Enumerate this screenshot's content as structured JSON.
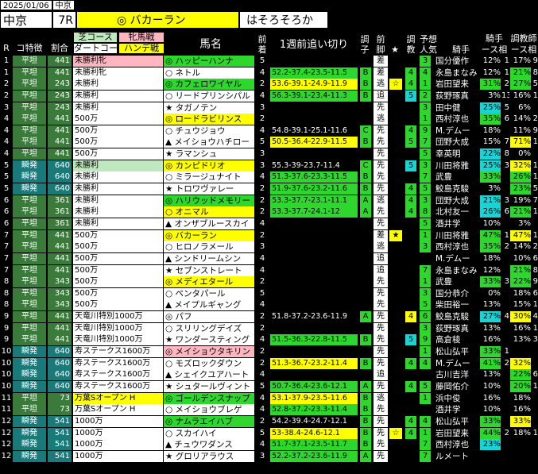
{
  "header": {
    "date": "2025/01/06",
    "place": "中京",
    "venue": "中京",
    "race": "7R",
    "favorite": "◎ バカーラン",
    "comment": "はそろそろか"
  },
  "columns": {
    "r": "R",
    "course_trait": "コ特徴",
    "ratio": "割合",
    "turf_course": "芝コース",
    "dirt_course": "ダートコー",
    "filly": "牝馬戦",
    "handicap": "ハンデ戦",
    "name": "馬名",
    "prev1": "前",
    "prev2": "着",
    "workout": "1週前追い切り",
    "cond1": "調",
    "cond2": "子",
    "pace1": "前",
    "pace2": "脚",
    "star": "★",
    "train1": "調",
    "train2": "教",
    "pop1": "予想",
    "pop2": "人気",
    "jockey": "騎手",
    "jstat1": "騎手",
    "jstat2": "ース相",
    "tstat1": "調教師",
    "tstat2": "ース相"
  },
  "rows": [
    {
      "r": "1",
      "trait": "平坦",
      "ratio": "441",
      "class": "未勝利牝",
      "cls": "pk",
      "name": "◎ ハッピーハンナ",
      "nc": "g",
      "prev": "5",
      "work": "",
      "wc": "",
      "cond": "",
      "pace": "差",
      "star": "",
      "tr": "",
      "tc": "",
      "pop": "3",
      "jockey": "国分優作",
      "js": "12%",
      "jn": "1",
      "ts": "17%",
      "tn": "9"
    },
    {
      "r": "1",
      "trait": "平坦",
      "ratio": "441",
      "class": "未勝利牝",
      "cls": "",
      "name": "○ ネトル",
      "nc": "",
      "prev": "4",
      "work": "52.2-37.4-23.5-11.5",
      "wc": "g",
      "cond": "B",
      "pace": "差",
      "star": "",
      "tr": "4",
      "tc": "gb",
      "pop": "4",
      "jockey": "永島まなみ",
      "js": "12%",
      "jn": "1",
      "ts": "21%",
      "tn": "8"
    },
    {
      "r": "2",
      "trait": "平坦",
      "ratio": "243",
      "class": "未勝利",
      "cls": "",
      "name": "◎ カフェロワイヤル",
      "nc": "g",
      "prev": "2",
      "work": "53.6-39.1-24.9-11.9",
      "wc": "y",
      "cond": "B",
      "pace": "逃",
      "star": "☆",
      "tr": "4",
      "tc": "gb",
      "pop": "1",
      "jockey": "岩田望来",
      "js": "31%",
      "jn": "2",
      "ts": "27%",
      "tn": "5"
    },
    {
      "r": "2",
      "trait": "平坦",
      "ratio": "243",
      "class": "未勝利",
      "cls": "",
      "name": "○ リードプリンシパル",
      "nc": "",
      "prev": "4",
      "work": "56.3-39.1-23.4-11.3",
      "wc": "g",
      "cond": "B",
      "pace": "追",
      "star": "",
      "tr": "5",
      "tc": "cy",
      "pop": "2",
      "jockey": "荻野琢真",
      "js": "3%",
      "jn": "13",
      "ts": "16%",
      "tn": "1"
    },
    {
      "r": "3",
      "trait": "平坦",
      "ratio": "243",
      "class": "未勝利",
      "cls": "",
      "name": "★ タガノテン",
      "nc": "",
      "prev": "3",
      "work": "",
      "wc": "",
      "cond": "",
      "pace": "先",
      "star": "",
      "tr": "",
      "tc": "",
      "pop": "3",
      "jockey": "田中健",
      "js": "25%",
      "jn": "5",
      "ts": "6%",
      "tn": ""
    },
    {
      "r": "4",
      "trait": "平坦",
      "ratio": "441",
      "class": "500万",
      "cls": "",
      "name": "◎ ロードラビリンス",
      "nc": "y",
      "prev": "2",
      "work": "",
      "wc": "",
      "cond": "",
      "pace": "逃",
      "star": "",
      "tr": "",
      "tc": "",
      "pop": "1",
      "jockey": "西村淳也",
      "js": "35%",
      "jn": "6",
      "ts": "14%",
      "tn": "2"
    },
    {
      "r": "4",
      "trait": "平坦",
      "ratio": "441",
      "class": "500万",
      "cls": "",
      "name": "○ チュウジョウ",
      "nc": "",
      "prev": "4",
      "work": "54.8-39.1-25.1-11.6",
      "wc": "",
      "cond": "C",
      "pace": "先",
      "star": "",
      "tr": "4",
      "tc": "gb",
      "pop": "9",
      "jockey": "M.デムー",
      "js": "18%",
      "jn": "",
      "ts": "11%",
      "tn": "9"
    },
    {
      "r": "4",
      "trait": "平坦",
      "ratio": "441",
      "class": "500万",
      "cls": "",
      "name": "▲ メイショウハチロー",
      "nc": "",
      "prev": "5",
      "work": "50.5-36.4-22.9-11.5",
      "wc": "y",
      "cond": "B",
      "pace": "先",
      "star": "",
      "tr": "5",
      "tc": "gb",
      "pop": "7",
      "jockey": "団野大成",
      "js": "15%",
      "jn": "7",
      "ts": "71%",
      "tn": "1"
    },
    {
      "r": "4",
      "trait": "平坦",
      "ratio": "441",
      "class": "500万",
      "cls": "",
      "name": "★ ラマンシュ",
      "nc": "",
      "prev": "3",
      "work": "",
      "wc": "",
      "cond": "",
      "pace": "先",
      "star": "",
      "tr": "",
      "tc": "",
      "pop": "5",
      "jockey": "幸英明",
      "js": "22%",
      "jn": "8",
      "ts": "0%",
      "tn": ""
    },
    {
      "r": "5",
      "trait": "瞬発",
      "ratio": "640",
      "class": "未勝利",
      "cls": "gr",
      "name": "◎ カンピドリオ",
      "nc": "y",
      "prev": "3",
      "work": "55.3-39-23.7-11.4",
      "wc": "",
      "cond": "C",
      "pace": "先",
      "star": "",
      "tr": "5",
      "tc": "cy",
      "pop": "3",
      "jockey": "川田将雅",
      "js": "25%",
      "jn": "3",
      "ts": "32%",
      "tn": "1"
    },
    {
      "r": "5",
      "trait": "瞬発",
      "ratio": "640",
      "class": "未勝利",
      "cls": "",
      "name": "○ ミラージュナイト",
      "nc": "",
      "prev": "4",
      "work": "51.3-37.6-23.3-11.5",
      "wc": "g",
      "cond": "B",
      "pace": "先",
      "star": "",
      "tr": "",
      "tc": "",
      "pop": "7",
      "jockey": "武豊",
      "js": "33%",
      "jn": "",
      "ts": "26%",
      "tn": "1"
    },
    {
      "r": "5",
      "trait": "瞬発",
      "ratio": "640",
      "class": "未勝利",
      "cls": "",
      "name": "★ トロワヴァレー",
      "nc": "",
      "prev": "2",
      "work": "51.9-37.6-23.2-11.6",
      "wc": "g",
      "cond": "B",
      "pace": "先",
      "star": "",
      "tr": "4",
      "tc": "gb",
      "pop": "5",
      "jockey": "鮫島克駿",
      "js": "3%",
      "jn": "",
      "ts": "23%",
      "tn": "5"
    },
    {
      "r": "6",
      "trait": "平坦",
      "ratio": "361",
      "class": "未勝利",
      "cls": "",
      "name": "◎ ハリウッドメモリー",
      "nc": "g",
      "prev": "2",
      "work": "53.3-37.7-23.1-11.1",
      "wc": "g",
      "cond": "A",
      "pace": "逃",
      "star": "",
      "tr": "4",
      "tc": "gb",
      "pop": "3",
      "jockey": "団野大成",
      "js": "21%",
      "jn": "3",
      "ts": "19%",
      "tn": "7"
    },
    {
      "r": "6",
      "trait": "平坦",
      "ratio": "361",
      "class": "未勝利",
      "cls": "",
      "name": "○ オニマル",
      "nc": "y",
      "prev": "2",
      "work": "53.3-37.7-24.1-12",
      "wc": "g",
      "cond": "A",
      "pace": "先",
      "star": "",
      "tr": "4",
      "tc": "gb",
      "pop": "8",
      "jockey": "北村友一",
      "js": "26%",
      "jn": "6",
      "ts": "21%",
      "tn": "1"
    },
    {
      "r": "6",
      "trait": "平坦",
      "ratio": "361",
      "class": "未勝利",
      "cls": "",
      "name": "▲ オンザブルースカイ",
      "nc": "",
      "prev": "4",
      "work": "",
      "wc": "",
      "cond": "",
      "pace": "先",
      "star": "",
      "tr": "",
      "tc": "",
      "pop": "5",
      "jockey": "酒井学",
      "js": "10%",
      "jn": "",
      "ts": "3%",
      "tn": ""
    },
    {
      "r": "7",
      "trait": "平坦",
      "ratio": "441",
      "class": "500万",
      "cls": "",
      "name": "◎ バカーラン",
      "nc": "y",
      "prev": "2",
      "work": "",
      "wc": "",
      "cond": "",
      "pace": "差",
      "star": "★",
      "tr": "",
      "tc": "",
      "pop": "1",
      "jockey": "川田将雅",
      "js": "47%",
      "jn": "1",
      "ts": "47%",
      "tn": "1"
    },
    {
      "r": "7",
      "trait": "平坦",
      "ratio": "441",
      "class": "500万",
      "cls": "",
      "name": "○ ヒロノラメール",
      "nc": "",
      "prev": "3",
      "work": "",
      "wc": "",
      "cond": "",
      "pace": "逃",
      "star": "",
      "tr": "",
      "tc": "",
      "pop": "3",
      "jockey": "西村淳也",
      "js": "35%",
      "jn": "2",
      "ts": "14%",
      "tn": "2"
    },
    {
      "r": "7",
      "trait": "平坦",
      "ratio": "441",
      "class": "500万",
      "cls": "",
      "name": "▲ シンドリームシン",
      "nc": "",
      "prev": "4",
      "work": "",
      "wc": "",
      "cond": "",
      "pace": "追",
      "star": "",
      "tr": "",
      "tc": "",
      "pop": "",
      "jockey": "M.デムー",
      "js": "18%",
      "jn": "",
      "ts": "10%",
      "tn": "6"
    },
    {
      "r": "7",
      "trait": "平坦",
      "ratio": "441",
      "class": "500万",
      "cls": "",
      "name": "★ セブンストレート",
      "nc": "",
      "prev": "4",
      "work": "",
      "wc": "",
      "cond": "",
      "pace": "追",
      "star": "",
      "tr": "",
      "tc": "",
      "pop": "7",
      "jockey": "永島まなみ",
      "js": "12%",
      "jn": "",
      "ts": "21%",
      "tn": "8"
    },
    {
      "r": "8",
      "trait": "平坦",
      "ratio": "343",
      "class": "500万",
      "cls": "",
      "name": "◎ メディエタール",
      "nc": "y",
      "prev": "2",
      "work": "",
      "wc": "",
      "cond": "",
      "pace": "先",
      "star": "",
      "tr": "",
      "tc": "",
      "pop": "1",
      "jockey": "武豊",
      "js": "33%",
      "jn": "3",
      "ts": "22%",
      "tn": "9"
    },
    {
      "r": "8",
      "trait": "平坦",
      "ratio": "343",
      "class": "500万",
      "cls": "",
      "name": "○ ペンタパール",
      "nc": "",
      "prev": "5",
      "work": "",
      "wc": "",
      "cond": "",
      "pace": "先",
      "star": "",
      "tr": "",
      "tc": "",
      "pop": "3",
      "jockey": "国分恭介",
      "js": "0%",
      "jn": "",
      "ts": "18%",
      "tn": "6"
    },
    {
      "r": "8",
      "trait": "平坦",
      "ratio": "343",
      "class": "500万",
      "cls": "",
      "name": "▲ メイプルギャング",
      "nc": "",
      "prev": "4",
      "work": "",
      "wc": "",
      "cond": "",
      "pace": "先",
      "star": "",
      "tr": "",
      "tc": "",
      "pop": "5",
      "jockey": "柴田裕一",
      "js": "13%",
      "jn": "",
      "ts": "15%",
      "tn": "1"
    },
    {
      "r": "9",
      "trait": "平坦",
      "ratio": "441",
      "class": "天竜川特別1000万",
      "cls": "",
      "name": "◎ パフ",
      "nc": "",
      "prev": "2",
      "work": "51.8-37.2-23.6-11.9",
      "wc": "",
      "cond": "A",
      "pace": "先",
      "star": "",
      "tr": "4",
      "tc": "yb",
      "pop": "6",
      "jockey": "鮫島克駿",
      "js": "27%",
      "jn": "4",
      "ts": "30%",
      "tn": "4"
    },
    {
      "r": "9",
      "trait": "平坦",
      "ratio": "441",
      "class": "天竜川特別1000万",
      "cls": "",
      "name": "○ スリリングデイズ",
      "nc": "",
      "prev": "2",
      "work": "",
      "wc": "",
      "cond": "",
      "pace": "先",
      "star": "",
      "tr": "",
      "tc": "",
      "pop": "3",
      "jockey": "荻野琢真",
      "js": "13%",
      "jn": "",
      "ts": "16%",
      "tn": "1"
    },
    {
      "r": "9",
      "trait": "平坦",
      "ratio": "441",
      "class": "天竜川特別1000万",
      "cls": "",
      "name": "★ ワンダースティング",
      "nc": "",
      "prev": "4",
      "work": "51.5-36.3-22.8-11.5",
      "wc": "g",
      "cond": "B",
      "pace": "先",
      "star": "",
      "tr": "5",
      "tc": "cy",
      "pop": "9",
      "jockey": "高倉稜",
      "js": "16%",
      "jn": "",
      "ts": "13%",
      "tn": "3"
    },
    {
      "r": "10",
      "trait": "瞬発",
      "ratio": "640",
      "class": "寿ステークス1600万",
      "cls": "",
      "name": "◎ メイショウタキリン",
      "nc": "pk",
      "prev": "2",
      "work": "",
      "wc": "",
      "cond": "",
      "pace": "先",
      "star": "",
      "tr": "",
      "tc": "",
      "pop": "1",
      "jockey": "松山弘平",
      "js": "33%",
      "jn": "1",
      "ts": "",
      "tn": ""
    },
    {
      "r": "10",
      "trait": "瞬発",
      "ratio": "640",
      "class": "寿ステークス1600万",
      "cls": "",
      "name": "○ モズロックダウン",
      "nc": "",
      "prev": "2",
      "work": "51.3-36.7-23.2-11.4",
      "wc": "y",
      "cond": "B",
      "pace": "先",
      "star": "",
      "tr": "4",
      "tc": "gb",
      "pop": "4",
      "jockey": "M.デムー",
      "js": "41%",
      "jn": "2",
      "ts": "32%",
      "tn": ""
    },
    {
      "r": "10",
      "trait": "瞬発",
      "ratio": "640",
      "class": "寿ステークス1600万",
      "cls": "",
      "name": "▲ シェイクユアハート",
      "nc": "",
      "prev": "4",
      "work": "",
      "wc": "",
      "cond": "",
      "pace": "追",
      "star": "",
      "tr": "",
      "tc": "",
      "pop": "",
      "jockey": "古川吉洋",
      "js": "13%",
      "jn": "",
      "ts": "22%",
      "tn": "6"
    },
    {
      "r": "10",
      "trait": "瞬発",
      "ratio": "640",
      "class": "寿ステークス1600万",
      "cls": "",
      "name": "★ シュタールヴィント",
      "nc": "",
      "prev": "5",
      "work": "50.7-36.4-23.6-12.1",
      "wc": "g",
      "cond": "A",
      "pace": "先",
      "star": "",
      "tr": "4",
      "tc": "gb",
      "pop": "5",
      "jockey": "藤岡佑介",
      "js": "10%",
      "jn": "",
      "ts": "20%",
      "tn": "1"
    },
    {
      "r": "11",
      "trait": "平坦",
      "ratio": "73",
      "class": "万葉Sオープン H",
      "cls": "yl",
      "name": "◎ ゴールデンスナップ",
      "nc": "g",
      "prev": "4",
      "work": "53.1-37.9-23.5-11.6",
      "wc": "y",
      "cond": "B",
      "pace": "逃",
      "star": "",
      "tr": "",
      "tc": "",
      "pop": "1",
      "jockey": "浜中俊",
      "js": "16%",
      "jn": "",
      "ts": "18%",
      "tn": ""
    },
    {
      "r": "11",
      "trait": "平坦",
      "ratio": "73",
      "class": "万葉Sオープン H",
      "cls": "",
      "name": "○ メイショウブレゲ",
      "nc": "",
      "prev": "4",
      "work": "52.8-37.2-23.3-11.4",
      "wc": "g",
      "cond": "B",
      "pace": "先",
      "star": "",
      "tr": "",
      "tc": "",
      "pop": "",
      "jockey": "酒井学",
      "js": "10%",
      "jn": "",
      "ts": "16%",
      "tn": ""
    },
    {
      "r": "12",
      "trait": "瞬発",
      "ratio": "541",
      "class": "1000万",
      "cls": "",
      "name": "◎ ナムラエイハブ",
      "nc": "g",
      "prev": "2",
      "work": "54.2-39.4-24.7-12.1",
      "wc": "",
      "cond": "B",
      "pace": "先",
      "star": "",
      "tr": "4",
      "tc": "gb",
      "pop": "4",
      "jockey": "松山弘平",
      "js": "33%",
      "jn": "",
      "ts": "33%",
      "tn": ""
    },
    {
      "r": "12",
      "trait": "瞬発",
      "ratio": "541",
      "class": "1000万",
      "cls": "",
      "name": "○ スカイハイ",
      "nc": "",
      "prev": "5",
      "work": "53-38.4-24.6-12.1",
      "wc": "y",
      "cond": "B",
      "pace": "先",
      "star": "☆",
      "tr": "4",
      "tc": "gb",
      "pop": "1",
      "jockey": "岩田望来",
      "js": "44%",
      "jn": "2",
      "ts": "18%",
      "tn": "1"
    },
    {
      "r": "12",
      "trait": "瞬発",
      "ratio": "541",
      "class": "1000万",
      "cls": "",
      "name": "▲ チュウワダンス",
      "nc": "",
      "prev": "4",
      "work": "51.7-37.1-23.5-11.7",
      "wc": "g",
      "cond": "B",
      "pace": "先",
      "star": "",
      "tr": "",
      "tc": "",
      "pop": "7",
      "jockey": "西村淳也",
      "js": "23%",
      "jn": "",
      "ts": "",
      "tn": ""
    },
    {
      "r": "12",
      "trait": "瞬発",
      "ratio": "541",
      "class": "1000万",
      "cls": "",
      "name": "★ グロリアラウス",
      "nc": "",
      "prev": "3",
      "work": "52.2-37.2-23.6-11.9",
      "wc": "g",
      "cond": "A",
      "pace": "先",
      "star": "",
      "tr": "",
      "tc": "",
      "pop": "7",
      "jockey": "ルメート",
      "js": "",
      "jn": "",
      "ts": "",
      "tn": ""
    }
  ]
}
